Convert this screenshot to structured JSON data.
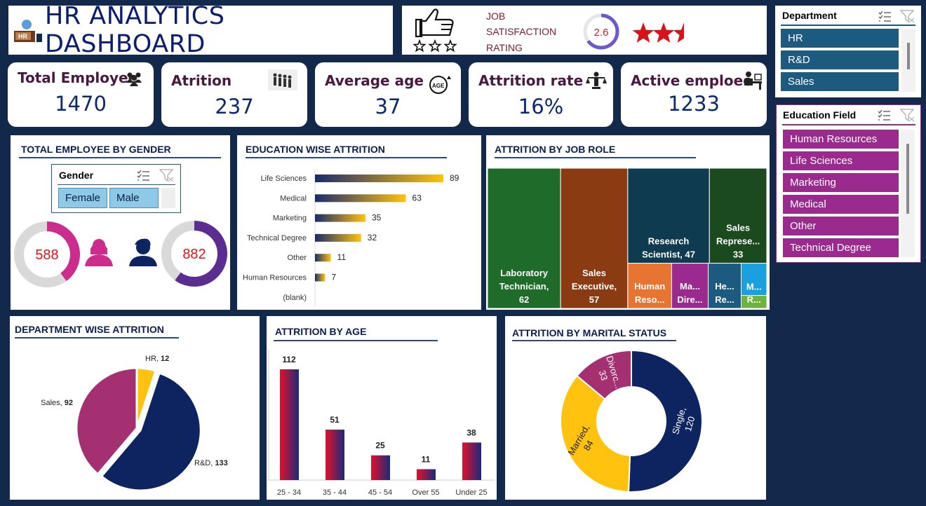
{
  "header": {
    "title": "HR ANALYTICS DASHBOARD",
    "logo_text": "HR"
  },
  "rating": {
    "label_lines": [
      "JOB",
      "SATISFACTION",
      "RATING"
    ],
    "value": "2.6",
    "stars_filled": 2.5,
    "stars_total": 3,
    "thumbs_stars": 3
  },
  "kpis": [
    {
      "label": "Total Employee",
      "value": "1470",
      "icon": "people-group-icon"
    },
    {
      "label": "Atrition",
      "value": "237",
      "icon": "people-leaving-icon"
    },
    {
      "label": "Average age",
      "value": "37",
      "icon": "age-icon"
    },
    {
      "label": "Attrition rate",
      "value": "16%",
      "icon": "balance-person-icon"
    },
    {
      "label": "Active emploee",
      "value": "1233",
      "icon": "person-at-desk-icon"
    }
  ],
  "department_slicer": {
    "title": "Department",
    "items": [
      "HR",
      "R&D",
      "Sales"
    ]
  },
  "education_slicer": {
    "title": "Education Field",
    "items": [
      "Human Resources",
      "Life Sciences",
      "Marketing",
      "Medical",
      "Other",
      "Technical Degree"
    ]
  },
  "gender_slicer": {
    "title": "Gender",
    "items": [
      "Female",
      "Male"
    ]
  },
  "charts": {
    "gender": {
      "title": "TOTAL EMPLOYEE BY GENDER"
    },
    "education": {
      "title": "EDUCATION WISE ATTRITION"
    },
    "jobrole": {
      "title": "ATTRITION BY JOB ROLE"
    },
    "department": {
      "title": "DEPARTMENT WISE ATTRITION"
    },
    "age": {
      "title": "ATTRITION BY AGE"
    },
    "marital": {
      "title": "ATTRITION BY MARITAL STATUS"
    }
  },
  "colors": {
    "background": "#13294b",
    "slicer_teal": "#1c5b7f",
    "slicer_purple": "#9b2a8f",
    "female": "#cc2d8c",
    "male": "#5b2d91",
    "navy": "#0d2461",
    "gold": "#ffc20e",
    "plum": "#a43072"
  },
  "chart_data": [
    {
      "name": "gender",
      "type": "pie",
      "title": "TOTAL EMPLOYEE BY GENDER",
      "categories": [
        "Female",
        "Male"
      ],
      "values": [
        588,
        882
      ],
      "labels": [
        "588",
        "882"
      ]
    },
    {
      "name": "education",
      "type": "bar",
      "title": "EDUCATION WISE ATTRITION",
      "categories": [
        "Life Sciences",
        "Medical",
        "Marketing",
        "Technical Degree",
        "Other",
        "Human Resources",
        "(blank)"
      ],
      "values": [
        89,
        63,
        35,
        32,
        11,
        7,
        null
      ],
      "orientation": "horizontal"
    },
    {
      "name": "jobrole",
      "type": "treemap",
      "title": "ATTRITION BY JOB ROLE",
      "categories": [
        "Laboratory Technician",
        "Sales Executive",
        "Research Scientist",
        "Sales Representative",
        "Human Resources",
        "Manufacturing Director",
        "Healthcare Representative",
        "Manager",
        "Research Director"
      ],
      "values": [
        62,
        57,
        47,
        33,
        12,
        10,
        9,
        5,
        2
      ],
      "labels": [
        [
          "Laboratory",
          "Technician,",
          "62"
        ],
        [
          "Sales",
          "Executive,",
          "57"
        ],
        [
          "Research",
          "Scientist, 47"
        ],
        [
          "Sales",
          "Represe...",
          "33"
        ],
        [
          "Human",
          "Reso..."
        ],
        [
          "Ma...",
          "Dire..."
        ],
        [
          "He...",
          "Re..."
        ],
        [
          "M..."
        ],
        [
          "R..."
        ]
      ],
      "colors": [
        "#1e6b2a",
        "#8b3b12",
        "#0f3b50",
        "#1b4a1e",
        "#e87432",
        "#9b2a8f",
        "#1c5b7f",
        "#1aa0dc",
        "#6db33f"
      ]
    },
    {
      "name": "department",
      "type": "pie",
      "title": "DEPARTMENT WISE ATTRITION",
      "categories": [
        "HR",
        "R&D",
        "Sales"
      ],
      "values": [
        12,
        133,
        92
      ],
      "labels": [
        [
          "HR, ",
          "12"
        ],
        [
          "R&D, ",
          "133"
        ],
        [
          "Sales, ",
          "92"
        ]
      ],
      "colors": [
        "#ffc20e",
        "#0d2461",
        "#a43072"
      ]
    },
    {
      "name": "age",
      "type": "bar",
      "title": "ATTRITION BY AGE",
      "categories": [
        "25 - 34",
        "35 - 44",
        "45 - 54",
        "Over 55",
        "Under 25"
      ],
      "values": [
        112,
        51,
        25,
        11,
        38
      ]
    },
    {
      "name": "marital",
      "type": "pie",
      "title": "ATTRITION BY MARITAL STATUS",
      "categories": [
        "Single",
        "Married",
        "Divorced"
      ],
      "values": [
        120,
        84,
        33
      ],
      "labels": [
        [
          "Single,",
          "120"
        ],
        [
          "Married,",
          "84"
        ],
        [
          "Divorc...",
          "33"
        ]
      ],
      "colors": [
        "#0d2461",
        "#ffc20e",
        "#a43072"
      ]
    }
  ]
}
